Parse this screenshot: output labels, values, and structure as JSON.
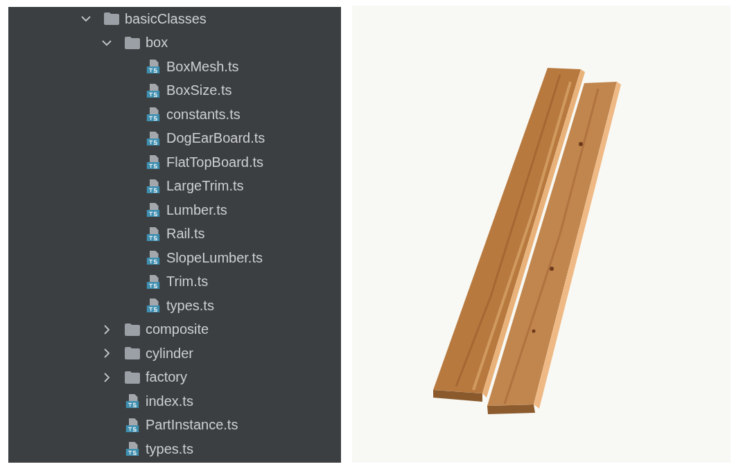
{
  "tree": [
    {
      "name": "basicClasses",
      "kind": "folder",
      "expanded": true,
      "children": [
        {
          "name": "box",
          "kind": "folder",
          "expanded": true,
          "children": [
            {
              "name": "BoxMesh.ts",
              "kind": "file"
            },
            {
              "name": "BoxSize.ts",
              "kind": "file"
            },
            {
              "name": "constants.ts",
              "kind": "file"
            },
            {
              "name": "DogEarBoard.ts",
              "kind": "file"
            },
            {
              "name": "FlatTopBoard.ts",
              "kind": "file"
            },
            {
              "name": "LargeTrim.ts",
              "kind": "file"
            },
            {
              "name": "Lumber.ts",
              "kind": "file"
            },
            {
              "name": "Rail.ts",
              "kind": "file"
            },
            {
              "name": "SlopeLumber.ts",
              "kind": "file"
            },
            {
              "name": "Trim.ts",
              "kind": "file"
            },
            {
              "name": "types.ts",
              "kind": "file"
            }
          ]
        },
        {
          "name": "composite",
          "kind": "folder",
          "expanded": false
        },
        {
          "name": "cylinder",
          "kind": "folder",
          "expanded": false
        },
        {
          "name": "factory",
          "kind": "folder",
          "expanded": false
        },
        {
          "name": "index.ts",
          "kind": "file"
        },
        {
          "name": "PartInstance.ts",
          "kind": "file"
        },
        {
          "name": "types.ts",
          "kind": "file"
        }
      ]
    }
  ]
}
